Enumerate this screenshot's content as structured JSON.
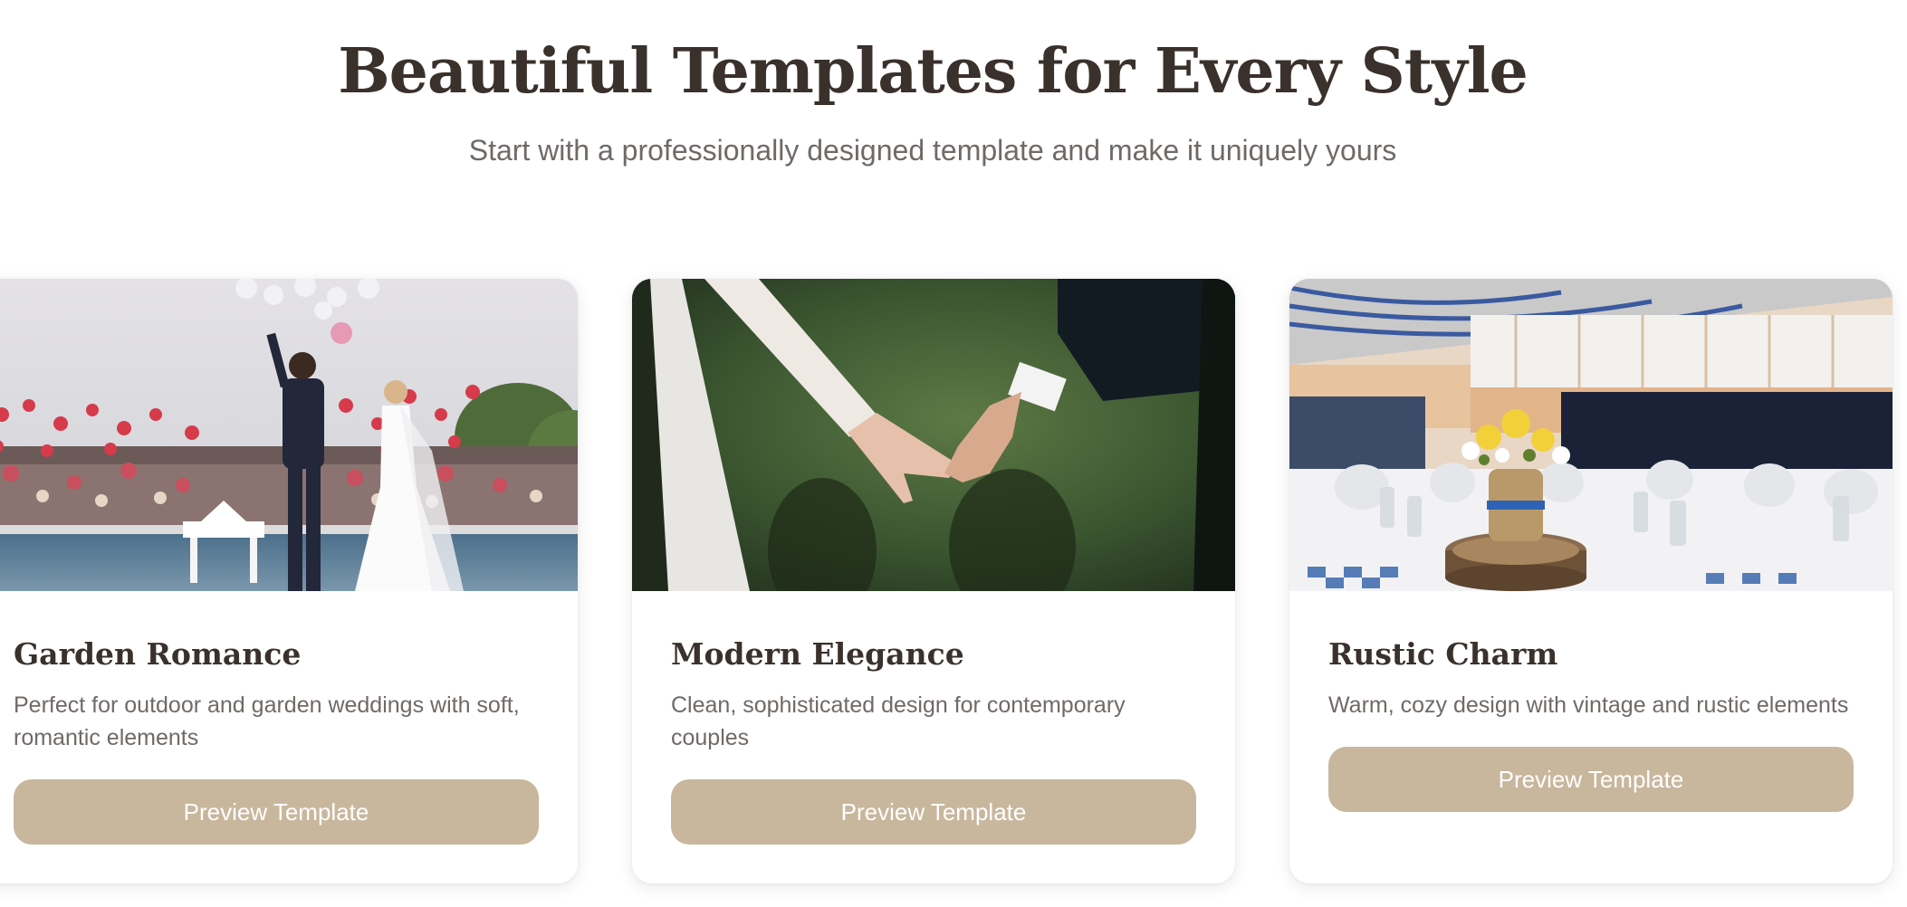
{
  "section": {
    "title": "Beautiful Templates for Every Style",
    "subtitle": "Start with a professionally designed template and make it uniquely yours"
  },
  "templates": [
    {
      "name": "Garden Romance",
      "description": "Perfect for outdoor and garden weddings with soft, romantic elements",
      "button_label": "Preview Template",
      "image": "couple-with-balloons-photo"
    },
    {
      "name": "Modern Elegance",
      "description": "Clean, sophisticated design for contemporary couples",
      "button_label": "Preview Template",
      "image": "holding-hands-photo"
    },
    {
      "name": "Rustic Charm",
      "description": "Warm, cozy design with vintage and rustic elements",
      "button_label": "Preview Template",
      "image": "reception-tables-photo"
    }
  ],
  "colors": {
    "button": "#c8b79d",
    "heading": "#3a302c",
    "body_text": "#6f6a66"
  }
}
